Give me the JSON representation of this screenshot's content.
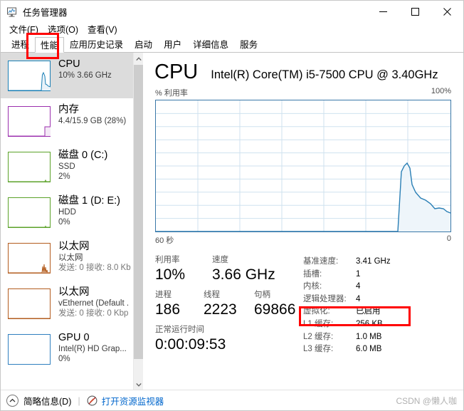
{
  "window": {
    "title": "任务管理器",
    "icon": "task-manager-icon",
    "minimize": "–",
    "maximize": "□",
    "close": "✕"
  },
  "menu": [
    {
      "label": "文件(F)"
    },
    {
      "label": "选项(O)"
    },
    {
      "label": "查看(V)"
    }
  ],
  "tabs": [
    {
      "label": "进程",
      "active": false
    },
    {
      "label": "性能",
      "active": true
    },
    {
      "label": "应用历史记录",
      "active": false
    },
    {
      "label": "启动",
      "active": false
    },
    {
      "label": "用户",
      "active": false
    },
    {
      "label": "详细信息",
      "active": false
    },
    {
      "label": "服务",
      "active": false
    }
  ],
  "sidebar": {
    "items": [
      {
        "title": "CPU",
        "line2": "10% 3.66 GHz",
        "line3": "",
        "color": "#1a7fb5",
        "selected": true
      },
      {
        "title": "内存",
        "line2": "4.4/15.9 GB (28%)",
        "line3": "",
        "color": "#9b2fae",
        "selected": false
      },
      {
        "title": "磁盘 0 (C:)",
        "line2": "SSD",
        "line3": "2%",
        "color": "#5ba229",
        "selected": false
      },
      {
        "title": "磁盘 1 (D: E:)",
        "line2": "HDD",
        "line3": "0%",
        "color": "#5ba229",
        "selected": false
      },
      {
        "title": "以太网",
        "line2": "以太网",
        "line3": "发送: 0 接收: 8.0 Kb",
        "color": "#b35c1e",
        "selected": false
      },
      {
        "title": "以太网",
        "line2": "vEthernet (Default .",
        "line3": "发送: 0 接收: 0 Kbp",
        "color": "#b35c1e",
        "selected": false
      },
      {
        "title": "GPU 0",
        "line2": "Intel(R) HD Grap...",
        "line3": "0%",
        "color": "#2f7fbf",
        "selected": false
      }
    ],
    "scroll_up_icon": "chevron-up-icon",
    "scroll_down_icon": "chevron-down-icon"
  },
  "main": {
    "title": "CPU",
    "model": "Intel(R) Core(TM) i5-7500 CPU @ 3.40GHz",
    "chart_axis_label": "% 利用率",
    "chart_max": "100%",
    "chart_time_left": "60 秒",
    "chart_time_right": "0",
    "stats": [
      {
        "label": "利用率",
        "value": "10%"
      },
      {
        "label": "速度",
        "value": "3.66 GHz"
      },
      {
        "label": "进程",
        "value": "186"
      },
      {
        "label": "线程",
        "value": "2223"
      },
      {
        "label": "句柄",
        "value": "69866"
      },
      {
        "label": "正常运行时间",
        "value": "0:00:09:53"
      }
    ],
    "specs": [
      {
        "key": "基准速度:",
        "value": "3.41 GHz"
      },
      {
        "key": "插槽:",
        "value": "1"
      },
      {
        "key": "内核:",
        "value": "4"
      },
      {
        "key": "逻辑处理器:",
        "value": "4"
      },
      {
        "key": "虚拟化:",
        "value": "已启用"
      },
      {
        "key": "L1 缓存:",
        "value": "256 KB"
      },
      {
        "key": "L2 缓存:",
        "value": "1.0 MB"
      },
      {
        "key": "L3 缓存:",
        "value": "6.0 MB"
      }
    ]
  },
  "chart_data": {
    "type": "area",
    "title": "CPU % 利用率",
    "xlabel": "",
    "ylabel": "% 利用率",
    "xlim": [
      60,
      0
    ],
    "ylim": [
      0,
      100
    ],
    "grid": true,
    "x_tick_labels": [
      "60 秒",
      "0"
    ],
    "y_tick_labels": [
      "100%"
    ],
    "series": [
      {
        "name": "CPU 利用率",
        "color": "#1a7fb5",
        "x": [
          60,
          52,
          51,
          50,
          49,
          48,
          47,
          46,
          45,
          44,
          43,
          42,
          41,
          40,
          39,
          38,
          37,
          36,
          35,
          34,
          33,
          32,
          31,
          30,
          29,
          28,
          27,
          26,
          25,
          24,
          23,
          22,
          21,
          20,
          19,
          18,
          17,
          16,
          15,
          14,
          13,
          12,
          11.5,
          11,
          10.5,
          10,
          9,
          8,
          7,
          6,
          5,
          4,
          3,
          2,
          1,
          0
        ],
        "values": [
          0,
          0,
          0,
          0,
          0,
          0,
          0,
          0,
          0,
          0,
          0,
          0,
          0,
          0,
          0,
          0,
          0,
          0,
          0,
          0,
          0,
          0,
          0,
          0,
          0,
          0,
          0,
          0,
          0,
          0,
          0,
          0,
          0,
          0,
          0,
          0,
          0,
          0,
          0,
          0,
          0,
          0,
          0,
          40,
          47,
          48,
          46,
          30,
          26,
          23,
          20,
          17,
          14,
          11,
          12,
          10
        ]
      }
    ]
  },
  "annotations": [
    {
      "name": "red-box-performance-tab",
      "target": "性能"
    },
    {
      "name": "red-box-virtualization",
      "target": "虚拟化: 已启用"
    }
  ],
  "statusbar": {
    "collapse_icon": "chevron-up-circle-icon",
    "collapse_label": "简略信息(D)",
    "separator": "|",
    "monitor_icon": "resource-monitor-icon",
    "monitor_link": "打开资源监视器",
    "watermark": "CSDN @懒人咖"
  }
}
